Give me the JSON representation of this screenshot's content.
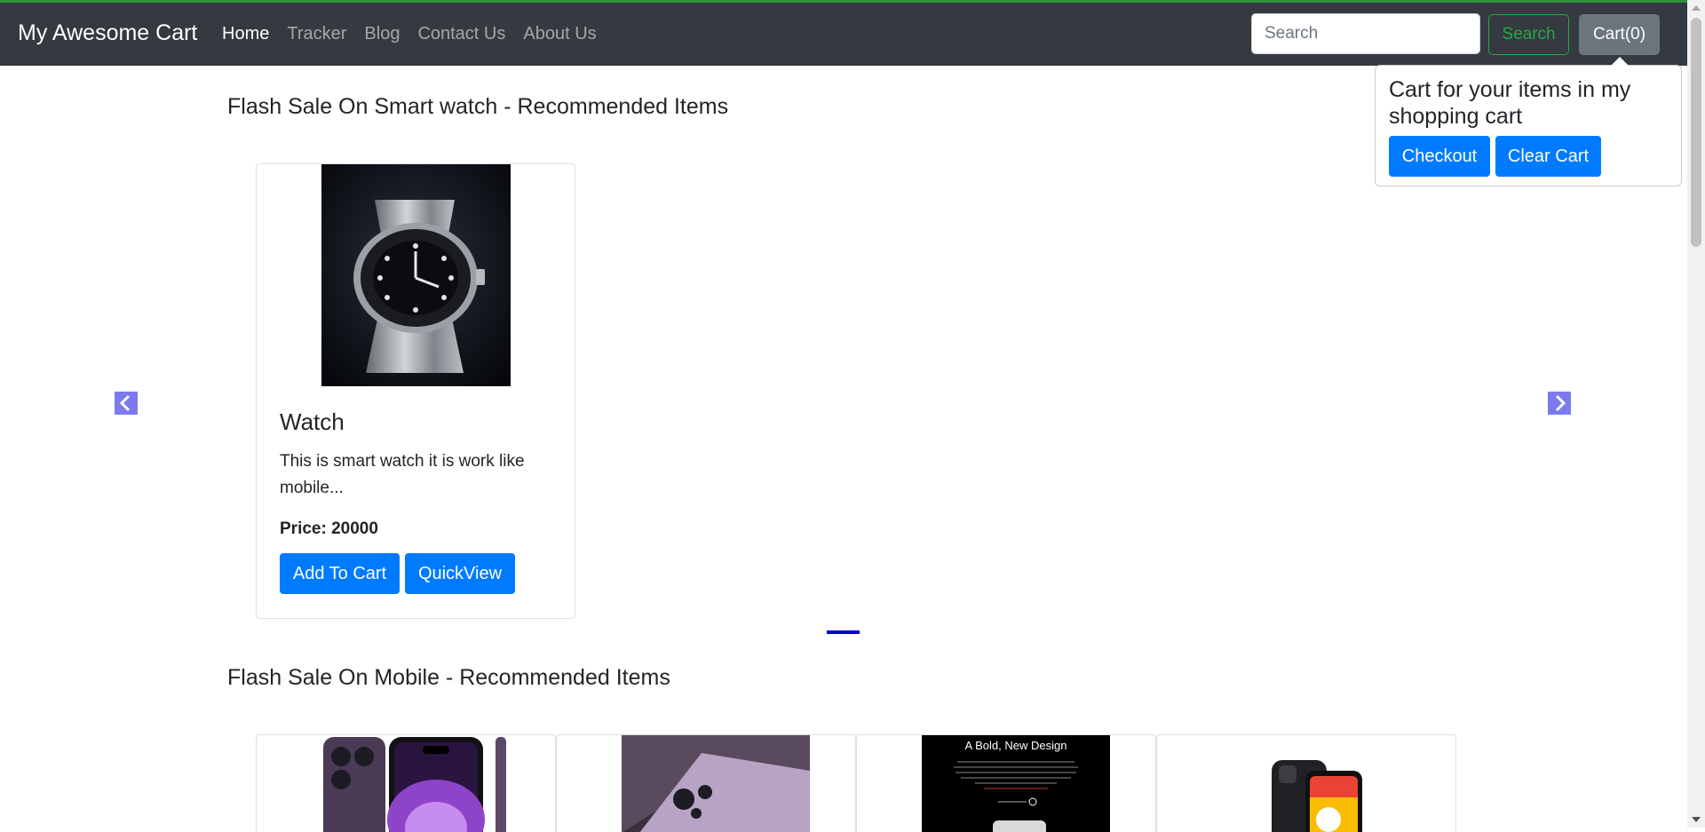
{
  "navbar": {
    "brand": "My Awesome Cart",
    "links": [
      "Home",
      "Tracker",
      "Blog",
      "Contact Us",
      "About Us"
    ],
    "active_link": "Home",
    "search": {
      "placeholder": "Search",
      "value": "",
      "button_label": "Search"
    },
    "cart_label": "Cart(0)"
  },
  "cart_popover": {
    "title": "Cart for your items in my shopping cart",
    "checkout_label": "Checkout",
    "clear_label": "Clear Cart"
  },
  "sections": [
    {
      "title": "Flash Sale On Smart watch - Recommended Items",
      "products": [
        {
          "name": "Watch",
          "description": "This is smart watch it is work like mobile...",
          "price_label": "Price: 20000",
          "add_label": "Add To Cart",
          "quickview_label": "QuickView",
          "image_icon": "wristwatch-image"
        }
      ],
      "active_slide": 1,
      "slide_count": 1
    },
    {
      "title": "Flash Sale On Mobile - Recommended Items",
      "products": [
        {
          "image_icon": "iphone-image"
        },
        {
          "image_icon": "purple-phone-image"
        },
        {
          "image_icon": "oneplus-promo-image",
          "image_text": "A Bold, New Design"
        },
        {
          "image_icon": "pixel-phone-image"
        }
      ]
    }
  ],
  "colors": {
    "navbar_bg": "#343a40",
    "primary": "#007bff",
    "success": "#28a745",
    "secondary": "#6c757d",
    "arrow": "#7b7bef",
    "indicator": "#0000cc"
  }
}
